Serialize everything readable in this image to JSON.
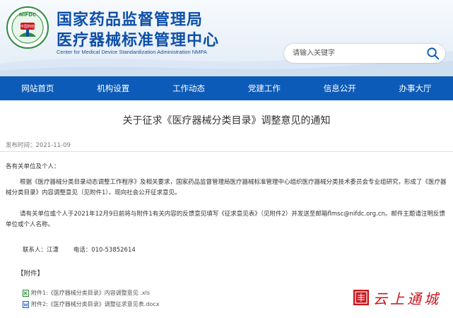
{
  "header": {
    "logo_text": "NIFDC",
    "logo_sub": "中国药检",
    "title_line1": "国家药品监督管理局",
    "title_line2": "医疗器械标准管理中心",
    "title_en": "Center for Medical Device Standardization Administration NMPA"
  },
  "search": {
    "placeholder": "请输入关键字"
  },
  "nav": {
    "items": [
      "网站首页",
      "机构设置",
      "工作动态",
      "党建工作",
      "信息公开",
      "办事大厅"
    ]
  },
  "article": {
    "title": "关于征求《医疗器械分类目录》调整意见的通知",
    "publish": "发布时间：2021-11-09",
    "greeting": "各有关单位及个人：",
    "para1": "根据《医疗器械分类目录动态调整工作程序》及相关要求，国家药品监督管理局医疗器械标准管理中心组织医疗器械分类技术委员会专业组研究，形成了《医疗器械分类目录》内容调整意见（见附件1）。现向社会公开征求意见。",
    "para2": "请有关单位或个人于2021年12月9日前将与附件1有关内容的反馈意见填写《征求意见表》（见附件2）并发送至邮箱flmsc@nifdc.org.cn。邮件主题请注明反馈单位或个人名称。",
    "contact_person": "联系人：江潇",
    "contact_phone": "电话：010-53852614"
  },
  "attachments": {
    "heading": "【附件】",
    "items": [
      "附件1:《医疗器械分类目录》内容调整意见 .xls",
      "附件2:《医疗器械分类目录》调整征求意见表.docx"
    ]
  },
  "watermark": {
    "text": "云上通城"
  },
  "colors": {
    "brand_blue": "#0c5bb8",
    "title_blue": "#0d4fa8",
    "seal_red": "#c8161d"
  }
}
